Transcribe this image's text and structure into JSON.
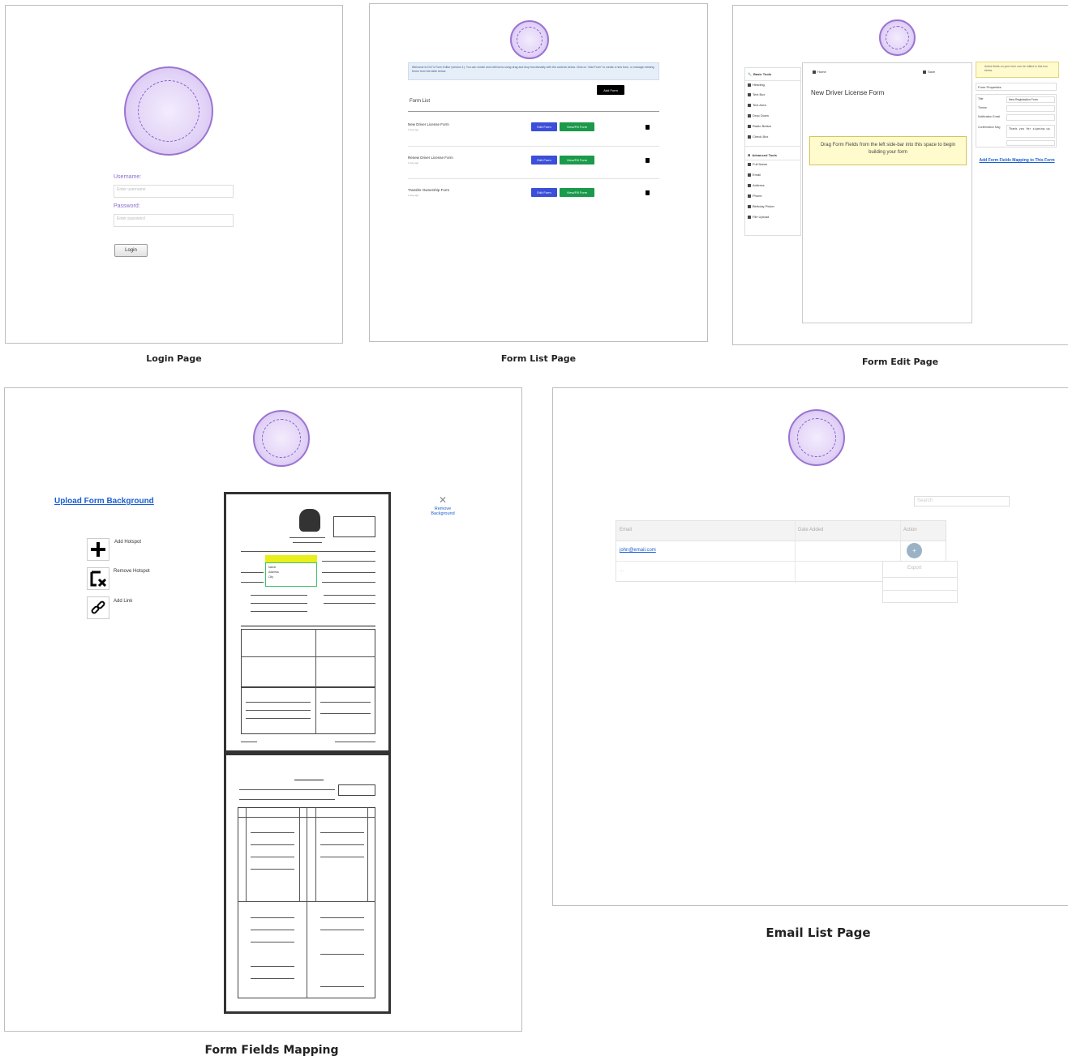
{
  "captions": {
    "login": "Login Page",
    "form_list": "Form List Page",
    "form_edit": "Form Edit Page",
    "mapping": "Form Fields Mapping",
    "email_list": "Email List Page"
  },
  "login": {
    "username_label": "Username:",
    "username_placeholder": "Enter username",
    "password_label": "Password:",
    "password_placeholder": "Enter password",
    "login_button": "Login"
  },
  "form_list": {
    "welcome": "Welcome to DLT's Form Editor (version 1). You can create and edit forms using drag and drop functionality with the controls below. Click on \"Add Form\" to create a new form, or manage existing forms from the table below.",
    "add_form_button": "Add Form",
    "section_title": "Form List",
    "rows": [
      {
        "name": "New Driver License Form",
        "date": "1 day ago",
        "edit": "Edit Form",
        "view": "View/Fill Form"
      },
      {
        "name": "Renew Driver License Form",
        "date": "1 day ago",
        "edit": "Edit Form",
        "view": "View/Fill Form"
      },
      {
        "name": "Transfer Ownership Form",
        "date": "1 day ago",
        "edit": "Edit Form",
        "view": "View/Fill Form"
      }
    ],
    "colors": {
      "edit": "#3b4fd8",
      "view": "#1a9a4a",
      "add": "#000000",
      "banner": "#e6eef8"
    }
  },
  "form_edit": {
    "basic_tools_title": "Basic Tools",
    "basic_tools": [
      "Heading",
      "Text Box",
      "Text Area",
      "Drop Down",
      "Radio Button",
      "Check Box"
    ],
    "advanced_tools_title": "Advanced Tools",
    "advanced_tools": [
      "Full Name",
      "Email",
      "Address",
      "Phone",
      "Birthday Picker",
      "File Upload"
    ],
    "home": "Home",
    "save": "Save",
    "form_title": "New Driver License Form",
    "drop_hint": "Drag Form Fields from the left side-bar into this space to begin building your form",
    "tip": "Active fields on your form can be edited in this box below.",
    "properties_title": "Form Properties",
    "props": [
      {
        "label": "Title",
        "value": "New Registration Form"
      },
      {
        "label": "Theme",
        "value": ""
      },
      {
        "label": "Notification Email",
        "value": ""
      },
      {
        "label": "Confirmation Msg",
        "value": "Thank you for signing up"
      }
    ],
    "mapping_link": "Add Form Fields Mapping to This Form"
  },
  "mapping": {
    "upload_link": "Upload Form Background",
    "remove_bg": "Remove Background",
    "tools": [
      {
        "label": "Add Hotspot",
        "icon": "plus-icon"
      },
      {
        "label": "Remove Hotspot",
        "icon": "remove-hotspot-icon"
      },
      {
        "label": "Add Link",
        "icon": "link-icon"
      }
    ],
    "dropdown_options": [
      "Name",
      "Address",
      "City"
    ]
  },
  "email_list": {
    "search_placeholder": "Search",
    "columns": [
      "Email",
      "Date Added",
      "Action"
    ],
    "rows": [
      {
        "email": "john@email.com",
        "date": "",
        "action": "+"
      },
      {
        "email": "...",
        "date": "",
        "action": ""
      }
    ],
    "menu_items": [
      "Export"
    ]
  }
}
